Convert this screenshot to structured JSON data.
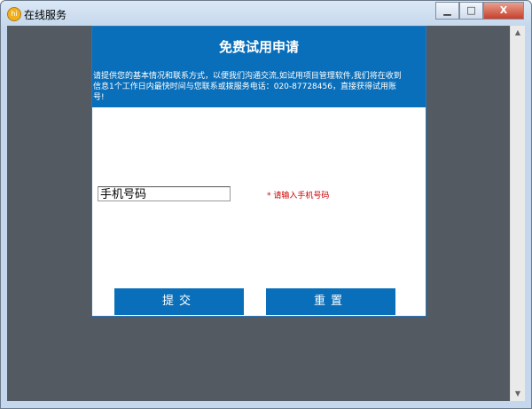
{
  "window": {
    "title": "在线服务",
    "icon": "hi-chat-icon",
    "minimize": "▁",
    "maximize": "□",
    "close": "X"
  },
  "form": {
    "heading": "免费试用申请",
    "description": "请提供您的基本情况和联系方式，以便我们沟通交流,如试用项目管理软件,我们将在收到信息1个工作日内最快时间与您联系或拨服务电话：020-87728456，直接获得试用账号!",
    "phone_value": "手机号码",
    "phone_hint": "* 请输入手机号码",
    "submit_label": "提交",
    "reset_label": "重置"
  },
  "scrollbar": {
    "up": "▲",
    "down": "▼"
  }
}
